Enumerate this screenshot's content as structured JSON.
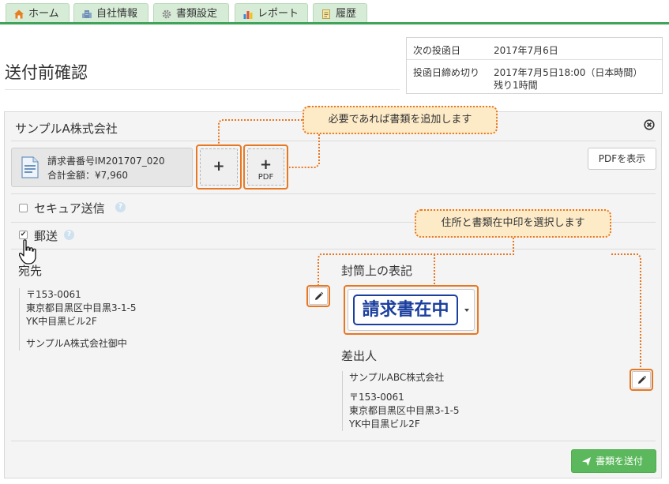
{
  "tabs": [
    {
      "label": "ホーム",
      "icon": "home-icon"
    },
    {
      "label": "自社情報",
      "icon": "building-icon"
    },
    {
      "label": "書類設定",
      "icon": "gear-icon"
    },
    {
      "label": "レポート",
      "icon": "bar-chart-icon"
    },
    {
      "label": "履歴",
      "icon": "history-icon"
    }
  ],
  "page": {
    "title": "送付前確認"
  },
  "info": {
    "next_post_label": "次の投函日",
    "next_post_value": "2017年7月6日",
    "deadline_label": "投函日締め切り",
    "deadline_value": "2017年7月5日18:00（日本時間）",
    "remaining": "残り1時間"
  },
  "panel": {
    "company": "サンプルA株式会社",
    "document": {
      "number": "請求書番号IM201707_020",
      "amount": "合計金額：¥7,960"
    },
    "add_button_plus": "+",
    "add_pdf_plus": "+",
    "add_pdf_label": "PDF",
    "show_pdf_label": "PDFを表示",
    "callout_add": "必要であれば書類を追加します",
    "callout_address": "住所と書類在中印を選択します",
    "secure_send_label": "セキュア送信",
    "postal_label": "郵送",
    "help_glyph": "?",
    "checked_glyph": "✔",
    "recipient": {
      "title": "宛先",
      "postal_code": "〒153-0061",
      "address": "東京都目黒区中目黒3-1-5",
      "building": "YK中目黒ビル2F",
      "name": "サンプルA株式会社御中"
    },
    "envelope": {
      "title": "封筒上の表記",
      "stamp": "請求書在中"
    },
    "sender": {
      "title": "差出人",
      "company": "サンプルABC株式会社",
      "postal_code": "〒153-0061",
      "address": "東京都目黒区中目黒3-1-5",
      "building": "YK中目黒ビル2F"
    },
    "send_button": "書類を送付"
  },
  "colors": {
    "tab_accent": "#3fa45a",
    "highlight": "#e87722",
    "callout_bg": "#fdebc8",
    "stamp": "#1b3f9e",
    "send_button": "#5cb85c"
  }
}
